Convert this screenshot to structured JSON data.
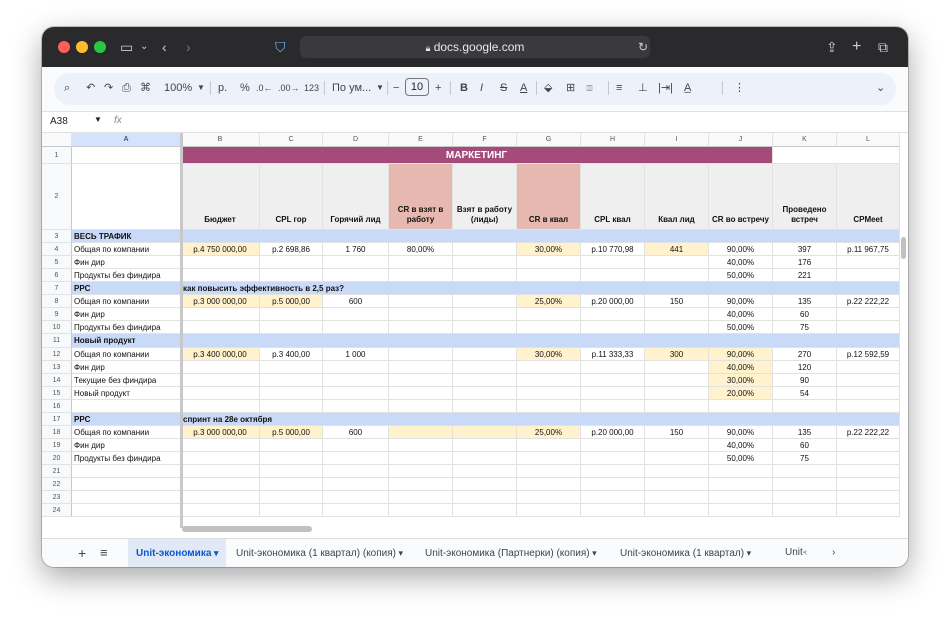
{
  "browser": {
    "url": "docs.google.com"
  },
  "toolbar": {
    "zoom": "100%",
    "currency": "р.",
    "percent": "%",
    "dec_down": ".0←",
    "dec_up": ".00→",
    "number_fmt": "123",
    "font": "По ум...",
    "font_size": "10",
    "bold": "B",
    "italic": "I",
    "strike": "S",
    "text_color": "A"
  },
  "formula_bar": {
    "cell_ref": "A38",
    "fx": "fx"
  },
  "columns": [
    "A",
    "B",
    "C",
    "D",
    "E",
    "F",
    "G",
    "H",
    "I",
    "J",
    "K",
    "L"
  ],
  "header": {
    "title": "МАРКЕТИНГ",
    "labels": [
      "Бюджет",
      "CPL гор",
      "Горячий лид",
      "CR в взят в работу",
      "Взят в работу (лиды)",
      "CR в квал",
      "CPL квал",
      "Квал лид",
      "CR во встречу",
      "Проведено встреч",
      "CPMeet"
    ]
  },
  "rows": [
    {
      "n": "3",
      "a": "ВЕСЬ ТРАФИК",
      "section": true
    },
    {
      "n": "4",
      "a": "Общая по компании",
      "b": "р.4 750 000,00",
      "c": "р.2 698,86",
      "d": "1 760",
      "e": "80,00%",
      "g": "30,00%",
      "h": "р.10 770,98",
      "i": "441",
      "j": "90,00%",
      "k": "397",
      "l": "р.11 967,75"
    },
    {
      "n": "5",
      "a": "Фин дир",
      "j": "40,00%",
      "k": "176"
    },
    {
      "n": "6",
      "a": "Продукты без финдира",
      "j": "50,00%",
      "k": "221"
    },
    {
      "n": "7",
      "a": "PPC",
      "b": "как повысить эффективность в 2,5 раз?",
      "section": true
    },
    {
      "n": "8",
      "a": "Общая по компании",
      "b": "р.3 000 000,00",
      "c": "р.5 000,00",
      "d": "600",
      "g": "25,00%",
      "h": "р.20 000,00",
      "i": "150",
      "j": "90,00%",
      "k": "135",
      "l": "р.22 222,22"
    },
    {
      "n": "9",
      "a": "Фин дир",
      "j": "40,00%",
      "k": "60"
    },
    {
      "n": "10",
      "a": "Продукты без финдира",
      "j": "50,00%",
      "k": "75"
    },
    {
      "n": "11",
      "a": "Новый продукт",
      "section": true
    },
    {
      "n": "12",
      "a": "Общая по компании",
      "b": "р.3 400 000,00",
      "c": "р.3 400,00",
      "d": "1 000",
      "g": "30,00%",
      "h": "р.11 333,33",
      "i": "300",
      "j": "90,00%",
      "k": "270",
      "l": "р.12 592,59"
    },
    {
      "n": "13",
      "a": "Фин дир",
      "j": "40,00%",
      "k": "120"
    },
    {
      "n": "14",
      "a": "Текущие без финдира",
      "j": "30,00%",
      "k": "90"
    },
    {
      "n": "15",
      "a": "Новый продукт",
      "j": "20,00%",
      "k": "54"
    },
    {
      "n": "16"
    },
    {
      "n": "17",
      "a": "PPC",
      "b": "спринт на 28е октября",
      "section": true
    },
    {
      "n": "18",
      "a": "Общая по компании",
      "b": "р.3 000 000,00",
      "c": "р.5 000,00",
      "d": "600",
      "g": "25,00%",
      "h": "р.20 000,00",
      "i": "150",
      "j": "90,00%",
      "k": "135",
      "l": "р.22 222,22"
    },
    {
      "n": "19",
      "a": "Фин дир",
      "j": "40,00%",
      "k": "60"
    },
    {
      "n": "20",
      "a": "Продукты без финдира",
      "j": "50,00%",
      "k": "75"
    },
    {
      "n": "21"
    },
    {
      "n": "22"
    },
    {
      "n": "23"
    },
    {
      "n": "24"
    }
  ],
  "tabs": [
    {
      "label": "Unit-экономика",
      "active": true
    },
    {
      "label": "Unit-экономика (1 квартал) (копия)"
    },
    {
      "label": "Unit-экономика (Партнерки) (копия)"
    },
    {
      "label": "Unit-экономика (1 квартал)"
    },
    {
      "label": "Unit-"
    }
  ],
  "colors": {
    "title_bg": "#a54b7c",
    "header_bg": "#efefef",
    "highlight_col": "#e6b8af",
    "section_bg": "#c9daf8",
    "yellow": "#fff2cc"
  }
}
